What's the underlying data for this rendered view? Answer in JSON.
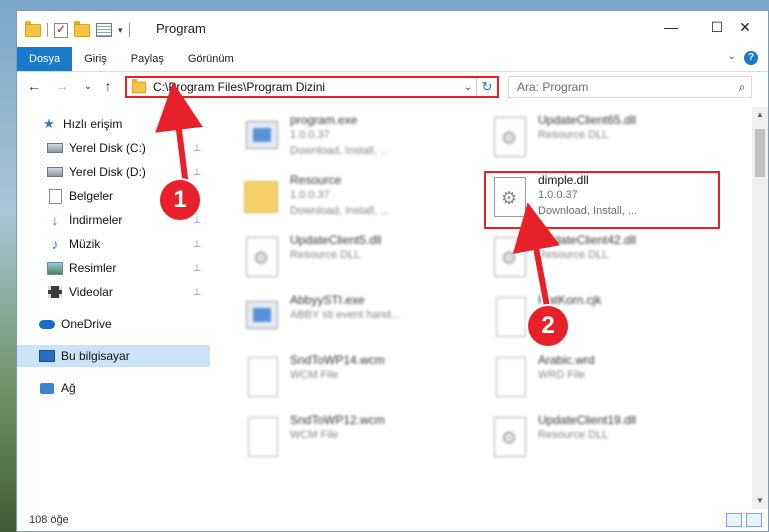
{
  "window": {
    "title": "Program",
    "qat_dropdown": "▾",
    "controls": {
      "minimize": "—",
      "maximize": "☐",
      "close": "✕"
    }
  },
  "ribbon": {
    "tabs": [
      "Dosya",
      "Giriş",
      "Paylaş",
      "Görünüm"
    ],
    "expand": "⌄",
    "help": "?"
  },
  "nav": {
    "back": "←",
    "forward": "→",
    "recent": "⌄",
    "up": "↑",
    "address": "C:\\Program Files\\Program Dizini",
    "address_dropdown": "⌄",
    "refresh": "↻",
    "search_placeholder": "Ara: Program",
    "search_icon": "⌕"
  },
  "sidebar": {
    "items": [
      {
        "label": "Hızlı erişim",
        "icon": "star-icon",
        "pinned": false
      },
      {
        "label": "Yerel Disk (C:)",
        "icon": "drive-icon",
        "pinned": true
      },
      {
        "label": "Yerel Disk (D:)",
        "icon": "drive-icon",
        "pinned": true
      },
      {
        "label": "Belgeler",
        "icon": "documents-icon",
        "pinned": true
      },
      {
        "label": "İndirmeler",
        "icon": "downloads-icon",
        "pinned": true
      },
      {
        "label": "Müzik",
        "icon": "music-icon",
        "pinned": true
      },
      {
        "label": "Resimler",
        "icon": "pictures-icon",
        "pinned": true
      },
      {
        "label": "Videolar",
        "icon": "videos-icon",
        "pinned": true
      },
      {
        "label": "OneDrive",
        "icon": "onedrive-icon",
        "pinned": false
      },
      {
        "label": "Bu bilgisayar",
        "icon": "this-pc-icon",
        "pinned": false
      },
      {
        "label": "Ağ",
        "icon": "network-icon",
        "pinned": false
      }
    ],
    "pin_glyph": "📌"
  },
  "files": {
    "left": [
      {
        "name": "program.exe",
        "line1": "1.0.0.37",
        "line2": "Download, Install, ...",
        "icon": "exe-icon"
      },
      {
        "name": "Resource",
        "line1": "1.0.0.37",
        "line2": "Download, Install, ...",
        "icon": "folder-icon"
      },
      {
        "name": "UpdateClient5.dll",
        "line1": "Resource DLL",
        "line2": "",
        "icon": "dll-icon"
      },
      {
        "name": "AbbyySTI.exe",
        "line1": "ABBY sti event hand...",
        "line2": "",
        "icon": "exe-icon"
      },
      {
        "name": "SndToWP14.wcm",
        "line1": "WCM File",
        "line2": "",
        "icon": "file-icon"
      },
      {
        "name": "SndToWP12.wcm",
        "line1": "WCM File",
        "line2": "",
        "icon": "file-icon"
      }
    ],
    "right": [
      {
        "name": "UpdateClient65.dll",
        "line1": "Resource DLL",
        "line2": "",
        "icon": "dll-icon"
      },
      {
        "name": "dimple.dll",
        "line1": "1.0.0.37",
        "line2": "Download, Install, ...",
        "icon": "dll-icon"
      },
      {
        "name": "UpdateClient42.dll",
        "line1": "Resource DLL",
        "line2": "",
        "icon": "dll-icon"
      },
      {
        "name": "FlatKorn.cjk",
        "line1": "",
        "line2": "",
        "icon": "file-icon"
      },
      {
        "name": "Arabic.wrd",
        "line1": "WRD File",
        "line2": "",
        "icon": "file-icon"
      },
      {
        "name": "UpdateClient19.dll",
        "line1": "Resource DLL",
        "line2": "",
        "icon": "dll-icon"
      }
    ]
  },
  "status": {
    "count": "108 öğe"
  },
  "annotations": {
    "callout_1": "1",
    "callout_2": "2",
    "accent": "#e8202a"
  },
  "colors": {
    "ribbon_active": "#1979ca",
    "selection": "#cce4f7"
  }
}
